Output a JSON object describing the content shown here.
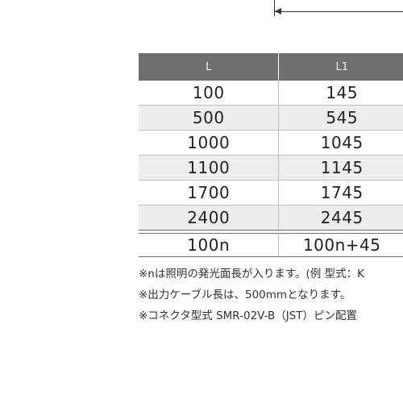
{
  "table": {
    "headers": {
      "l": "L",
      "l1": "L1"
    },
    "rows": [
      {
        "l": "100",
        "l1": "145"
      },
      {
        "l": "500",
        "l1": "545"
      },
      {
        "l": "1000",
        "l1": "1045"
      },
      {
        "l": "1100",
        "l1": "1145"
      },
      {
        "l": "1700",
        "l1": "1745"
      },
      {
        "l": "2400",
        "l1": "2445"
      }
    ],
    "formula": {
      "l": "100n",
      "l1": "100n+45"
    }
  },
  "notes": [
    "※nは照明の発光面長が入ります。(例 型式：K",
    "※出力ケーブル長は、500mmとなります。",
    "※コネクタ型式 SMR-02V-B（JST）ピン配置"
  ]
}
